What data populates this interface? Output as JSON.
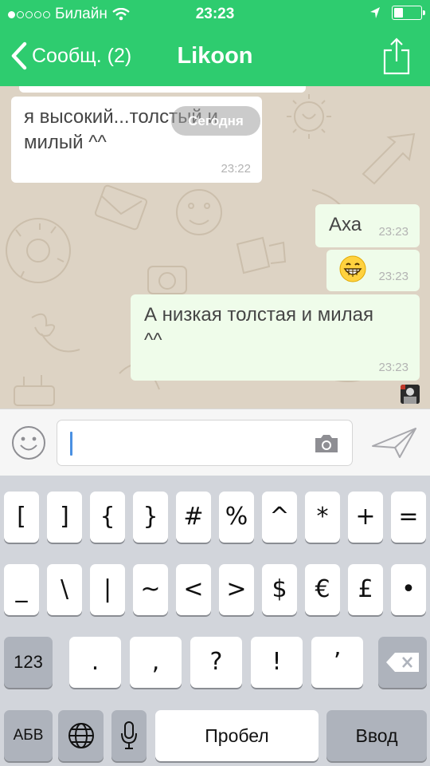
{
  "status_bar": {
    "signal_dots": [
      true,
      false,
      false,
      false,
      false
    ],
    "carrier": "Билайн",
    "wifi_icon": "wifi-icon",
    "time": "23:23",
    "location_icon": "location-arrow-icon",
    "battery_level": 0.35
  },
  "nav": {
    "back_label": "Сообщ. (2)",
    "title": "Likoon",
    "share_icon": "share-icon"
  },
  "chat": {
    "date_pill": "Сегодня",
    "messages": [
      {
        "direction": "in",
        "text_line1": "я высокий...толстый и",
        "text_line2": "милый ^^",
        "time": "23:22"
      },
      {
        "direction": "out",
        "text": "Аха",
        "time": "23:23"
      },
      {
        "direction": "out",
        "emoji": "grinning-face-emoji",
        "time": "23:23"
      },
      {
        "direction": "out",
        "text_line1": "А низкая толстая и милая",
        "text_line2": "^^",
        "time": "23:23"
      }
    ]
  },
  "input_bar": {
    "emoji_button_icon": "smiley-icon",
    "message_value": "",
    "camera_icon": "camera-icon",
    "send_icon": "send-icon"
  },
  "keyboard": {
    "row1": [
      "[",
      "]",
      "{",
      "}",
      "#",
      "%",
      "^",
      "*",
      "+",
      "="
    ],
    "row2": [
      "_",
      "\\",
      "|",
      "~",
      "<",
      ">",
      "$",
      "€",
      "£",
      "•"
    ],
    "row3": {
      "mode": "123",
      "keys": [
        ".",
        ",",
        "?",
        "!",
        "’"
      ],
      "delete_icon": "backspace-icon"
    },
    "row4": {
      "lang": "АБВ",
      "globe_icon": "globe-icon",
      "mic_icon": "microphone-icon",
      "space": "Пробел",
      "return": "Ввод"
    }
  },
  "colors": {
    "header_green": "#2ecc6f",
    "chat_background": "#ddd3c4",
    "outgoing_bubble": "#effcea",
    "incoming_bubble": "#ffffff"
  }
}
